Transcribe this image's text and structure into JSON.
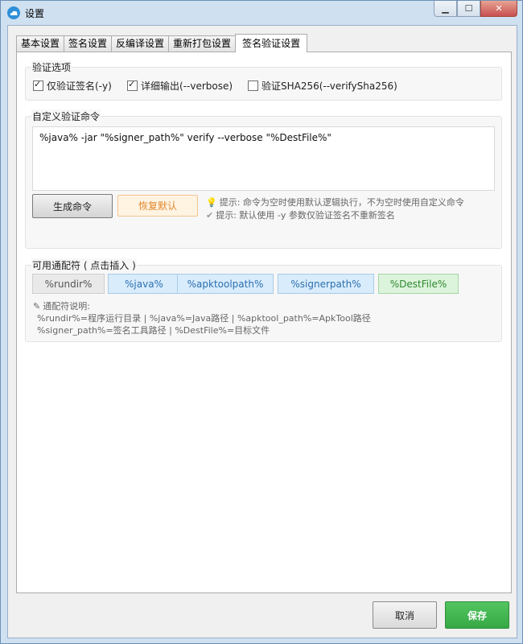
{
  "window": {
    "title": "设置"
  },
  "tabs": [
    {
      "label": "基本设置",
      "active": false
    },
    {
      "label": "签名设置",
      "active": false
    },
    {
      "label": "反编译设置",
      "active": false
    },
    {
      "label": "重新打包设置",
      "active": false
    },
    {
      "label": "签名验证设置",
      "active": true
    }
  ],
  "verify_options": {
    "title": "验证选项",
    "items": [
      {
        "label": "仅验证签名(-y)",
        "checked": true
      },
      {
        "label": "详细输出(--verbose)",
        "checked": true
      },
      {
        "label": "验证SHA256(--verifySha256)",
        "checked": false
      }
    ]
  },
  "custom_command": {
    "title": "自定义验证命令",
    "value": "%java% -jar \"%signer_path%\" verify --verbose \"%DestFile%\"",
    "generate_label": "生成命令",
    "restore_label": "恢复默认",
    "hint1": "提示: 命令为空时使用默认逻辑执行，不为空时使用自定义命令",
    "hint2": "提示: 默认使用 -y 参数仅验证签名不重新签名"
  },
  "wildcards": {
    "title": "可用通配符 ( 点击插入 )",
    "chips": [
      "%rundir%",
      "%java%",
      "%apktoolpath%",
      "%signerpath%",
      "%DestFile%"
    ],
    "legend_title": "通配符说明:",
    "legend_line1": "%rundir%=程序运行目录 | %java%=Java路径 | %apktool_path%=ApkTool路径",
    "legend_line2": "%signer_path%=签名工具路径 | %DestFile%=目标文件"
  },
  "footer": {
    "cancel_label": "取消",
    "save_label": "保存"
  },
  "colors": {
    "save_green": "#3cae4c",
    "restore_orange": "#f7a65a",
    "chip_blue": "#d9ecfb",
    "chip_green": "#dcf3dc"
  }
}
